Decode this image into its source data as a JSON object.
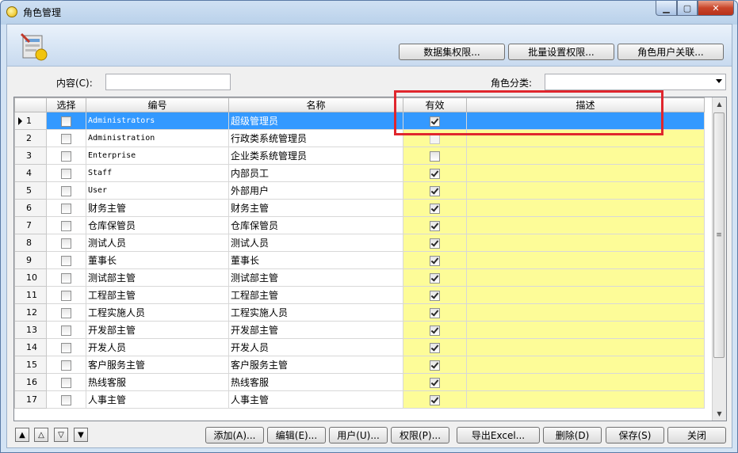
{
  "window": {
    "title": "角色管理"
  },
  "toolbar": {
    "dataset_perm_label": "数据集权限...",
    "batch_perm_label": "批量设置权限...",
    "role_user_label": "角色用户关联..."
  },
  "filter": {
    "content_label": "内容(C):",
    "content_value": "",
    "category_label": "角色分类:",
    "category_value": ""
  },
  "grid": {
    "columns": [
      "选择",
      "编号",
      "名称",
      "有效",
      "描述"
    ],
    "rows": [
      {
        "n": "1",
        "code": "Administrators",
        "name": "超级管理员",
        "valid": true,
        "selected": true
      },
      {
        "n": "2",
        "code": "Administration",
        "name": "行政类系统管理员",
        "valid": false,
        "disabled": true
      },
      {
        "n": "3",
        "code": "Enterprise",
        "name": "企业类系统管理员",
        "valid": false
      },
      {
        "n": "4",
        "code": "Staff",
        "name": "内部员工",
        "valid": true
      },
      {
        "n": "5",
        "code": "User",
        "name": "外部用户",
        "valid": true
      },
      {
        "n": "6",
        "code": "财务主管",
        "name": "财务主管",
        "valid": true
      },
      {
        "n": "7",
        "code": "仓库保管员",
        "name": "仓库保管员",
        "valid": true
      },
      {
        "n": "8",
        "code": "测试人员",
        "name": "测试人员",
        "valid": true
      },
      {
        "n": "9",
        "code": "董事长",
        "name": "董事长",
        "valid": true
      },
      {
        "n": "10",
        "code": "测试部主管",
        "name": "测试部主管",
        "valid": true
      },
      {
        "n": "11",
        "code": "工程部主管",
        "name": "工程部主管",
        "valid": true
      },
      {
        "n": "12",
        "code": "工程实施人员",
        "name": "工程实施人员",
        "valid": true
      },
      {
        "n": "13",
        "code": "开发部主管",
        "name": "开发部主管",
        "valid": true
      },
      {
        "n": "14",
        "code": "开发人员",
        "name": "开发人员",
        "valid": true
      },
      {
        "n": "15",
        "code": "客户服务主管",
        "name": "客户服务主管",
        "valid": true
      },
      {
        "n": "16",
        "code": "热线客服",
        "name": "热线客服",
        "valid": true
      },
      {
        "n": "17",
        "code": "人事主管",
        "name": "人事主管",
        "valid": true
      }
    ]
  },
  "footer": {
    "add_label": "添加(A)...",
    "edit_label": "编辑(E)...",
    "user_label": "用户(U)...",
    "perm_label": "权限(P)...",
    "export_label": "导出Excel...",
    "delete_label": "删除(D)",
    "save_label": "保存(S)",
    "close_label": "关闭"
  },
  "colors": {
    "accent_selected": "#3399ff",
    "valid_column_bg": "#fdfc98",
    "highlight_border": "#e0262d"
  }
}
